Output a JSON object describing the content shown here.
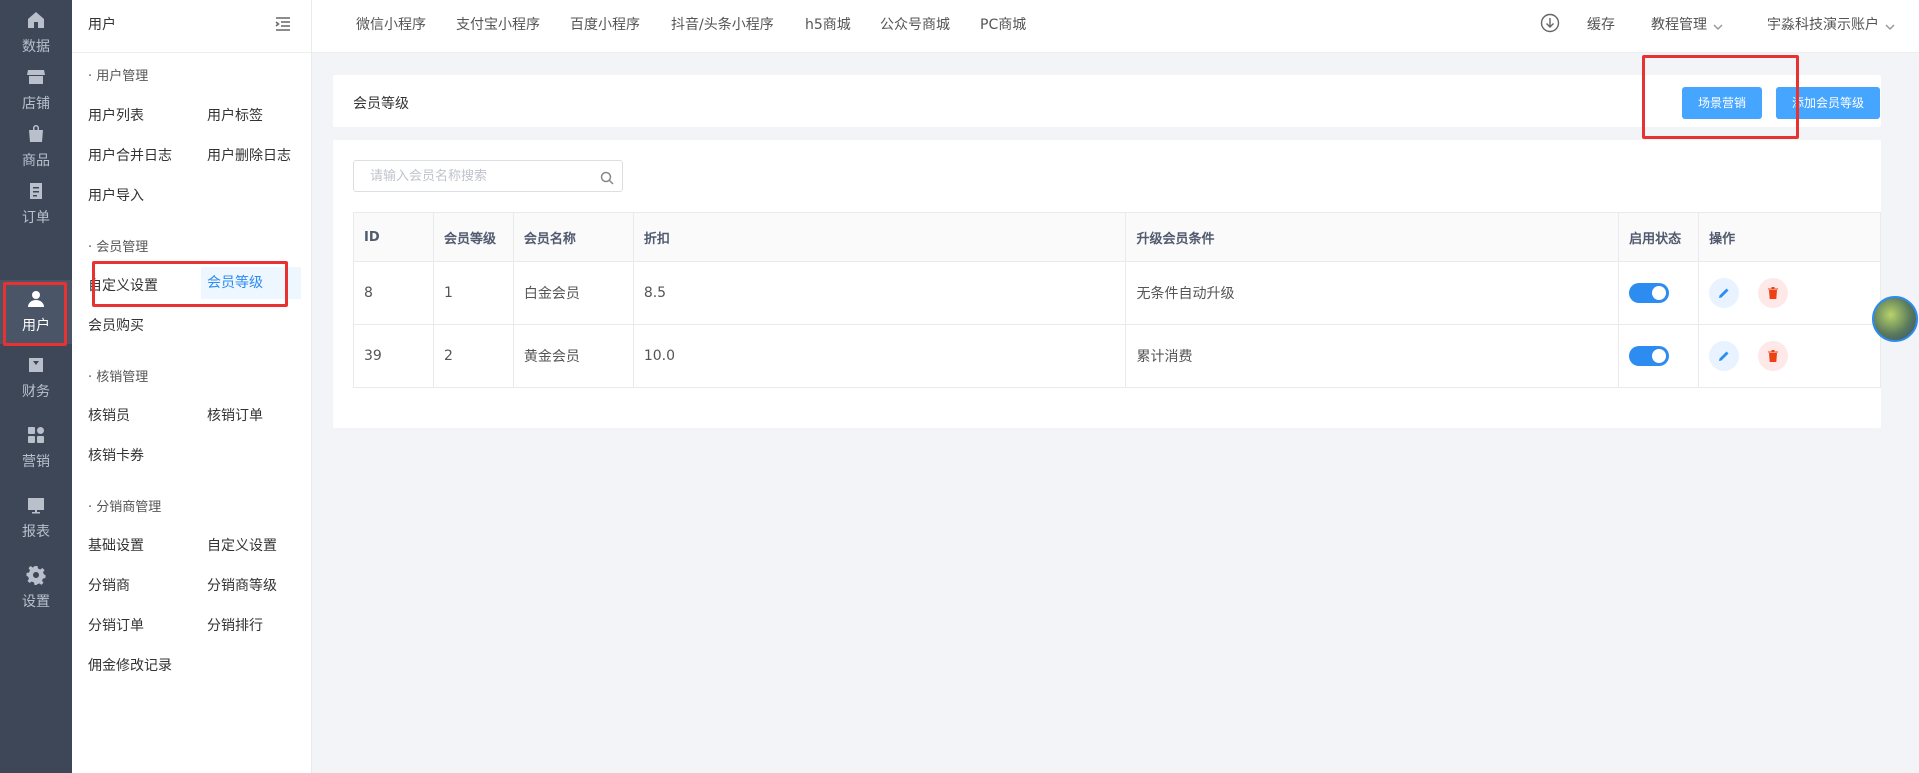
{
  "rail": [
    {
      "label": "数据",
      "icon": "home-icon"
    },
    {
      "label": "店铺",
      "icon": "store-icon"
    },
    {
      "label": "商品",
      "icon": "bag-icon"
    },
    {
      "label": "订单",
      "icon": "order-icon"
    },
    {
      "label": "用户",
      "icon": "user-icon",
      "active": true
    },
    {
      "label": "财务",
      "icon": "finance-icon"
    },
    {
      "label": "营销",
      "icon": "marketing-icon"
    },
    {
      "label": "报表",
      "icon": "report-icon"
    },
    {
      "label": "设置",
      "icon": "gear-icon"
    }
  ],
  "submenu": {
    "title": "用户",
    "groups": [
      {
        "title": "· 用户管理",
        "items": [
          "用户列表",
          "用户标签",
          "用户合并日志",
          "用户删除日志",
          "用户导入"
        ]
      },
      {
        "title": "· 会员管理",
        "items": [
          "自定义设置",
          "会员等级",
          "会员购买"
        ]
      },
      {
        "title": "· 核销管理",
        "items": [
          "核销员",
          "核销订单",
          "核销卡券"
        ]
      },
      {
        "title": "· 分销商管理",
        "items": [
          "基础设置",
          "自定义设置",
          "分销商",
          "分销商等级",
          "分销订单",
          "分销排行",
          "佣金修改记录"
        ]
      }
    ]
  },
  "topbar": {
    "tabs": [
      "微信小程序",
      "支付宝小程序",
      "百度小程序",
      "抖音/头条小程序",
      "h5商城",
      "公众号商城",
      "PC商城"
    ],
    "cache": "缓存",
    "tutorial": "教程管理",
    "account": "宇淼科技演示账户"
  },
  "header": {
    "title": "会员等级",
    "scene_button": "场景营销",
    "add_button": "添加会员等级"
  },
  "search": {
    "placeholder": "请输入会员名称搜索",
    "value": ""
  },
  "table": {
    "columns": [
      "ID",
      "会员等级",
      "会员名称",
      "折扣",
      "升级会员条件",
      "启用状态",
      "操作"
    ],
    "rows": [
      {
        "id": "8",
        "level": "1",
        "name": "白金会员",
        "discount": "8.5",
        "condition": "无条件自动升级",
        "enabled": true
      },
      {
        "id": "39",
        "level": "2",
        "name": "黄金会员",
        "discount": "10.0",
        "condition": "累计消费",
        "enabled": true
      }
    ]
  },
  "colors": {
    "rail_bg": "#3d4758",
    "primary": "#2d8cf0",
    "button": "#45a5ff",
    "highlight_border": "#e83232"
  }
}
